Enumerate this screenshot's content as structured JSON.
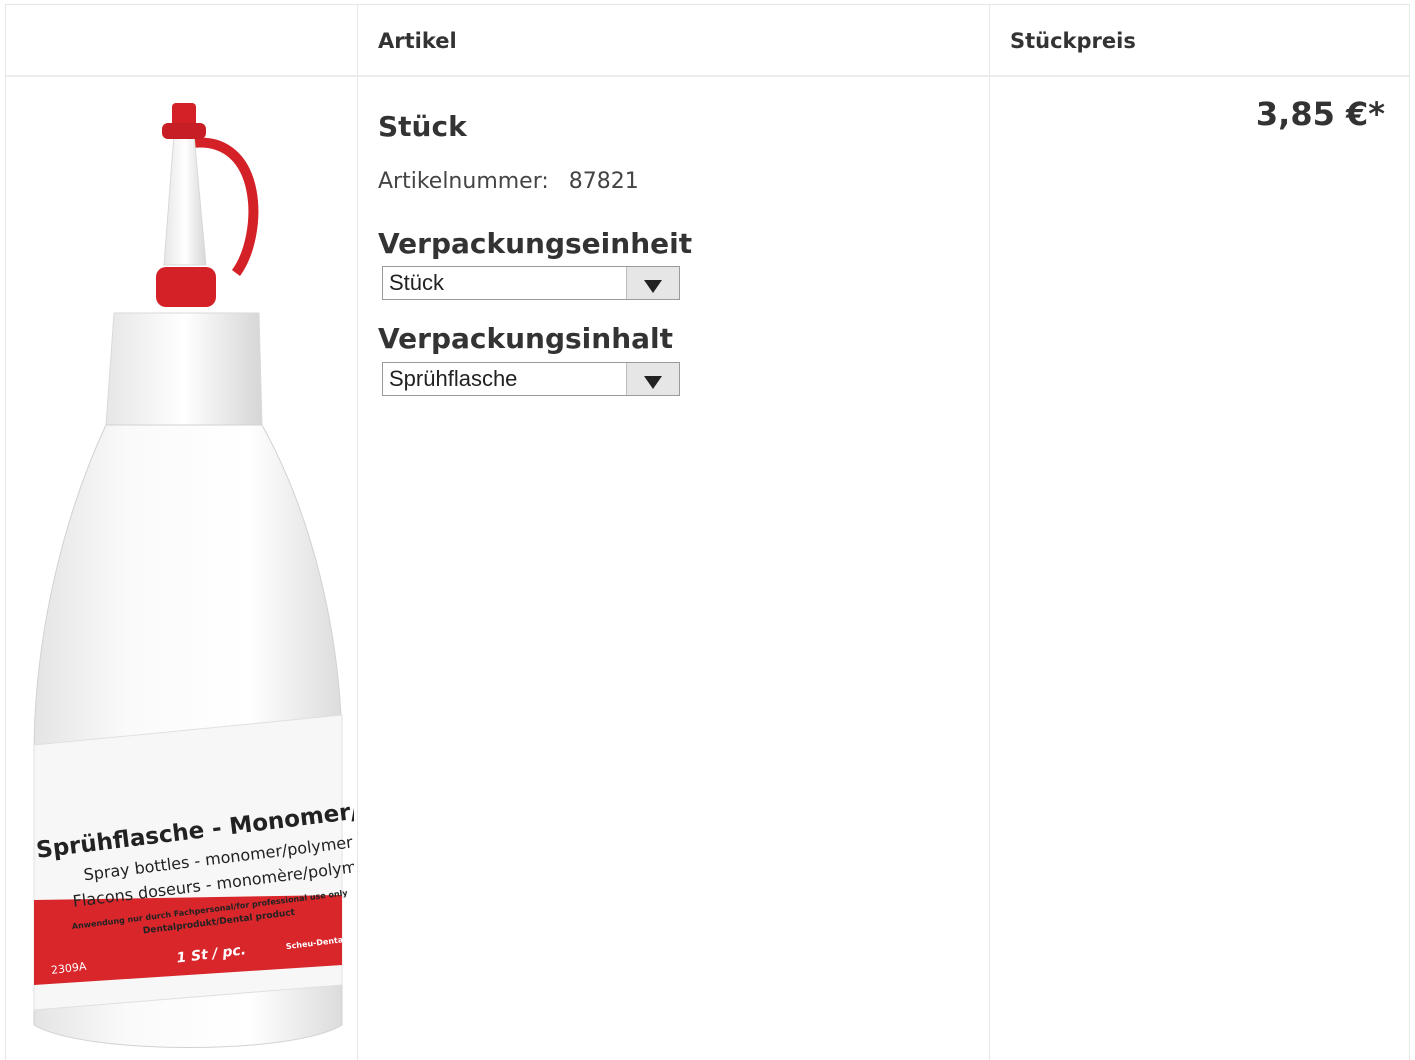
{
  "table": {
    "headers": [
      "",
      "Artikel",
      "Stückpreis"
    ]
  },
  "product": {
    "image": {
      "label_title": "Sprühflasche - Monomer/Poly",
      "label_line2": "Spray bottles - monomer/polymer",
      "label_line3": "Flacons doseurs - monomère/polymère",
      "label_line4": "Anwendung nur durch Fachpersonal/for professional use only",
      "label_line5": "Dentalprodukt/Dental product",
      "label_qty": "1 St / pc.",
      "label_code": "2309A",
      "label_brand": "Scheu-Dental"
    },
    "title": "Stück",
    "article_number_label": "Artikelnummer:",
    "article_number": "87821",
    "packaging_unit_label": "Verpackungseinheit",
    "packaging_unit_value": "Stück",
    "packaging_content_label": "Verpackungsinhalt",
    "packaging_content_value": "Sprühflasche",
    "price": "3,85 €*"
  },
  "colors": {
    "border": "#e6e6e6",
    "text": "#333333",
    "cap_red": "#d42027",
    "label_red": "#d8262b"
  },
  "icons": {
    "dropdown": "triangle-down-icon"
  }
}
